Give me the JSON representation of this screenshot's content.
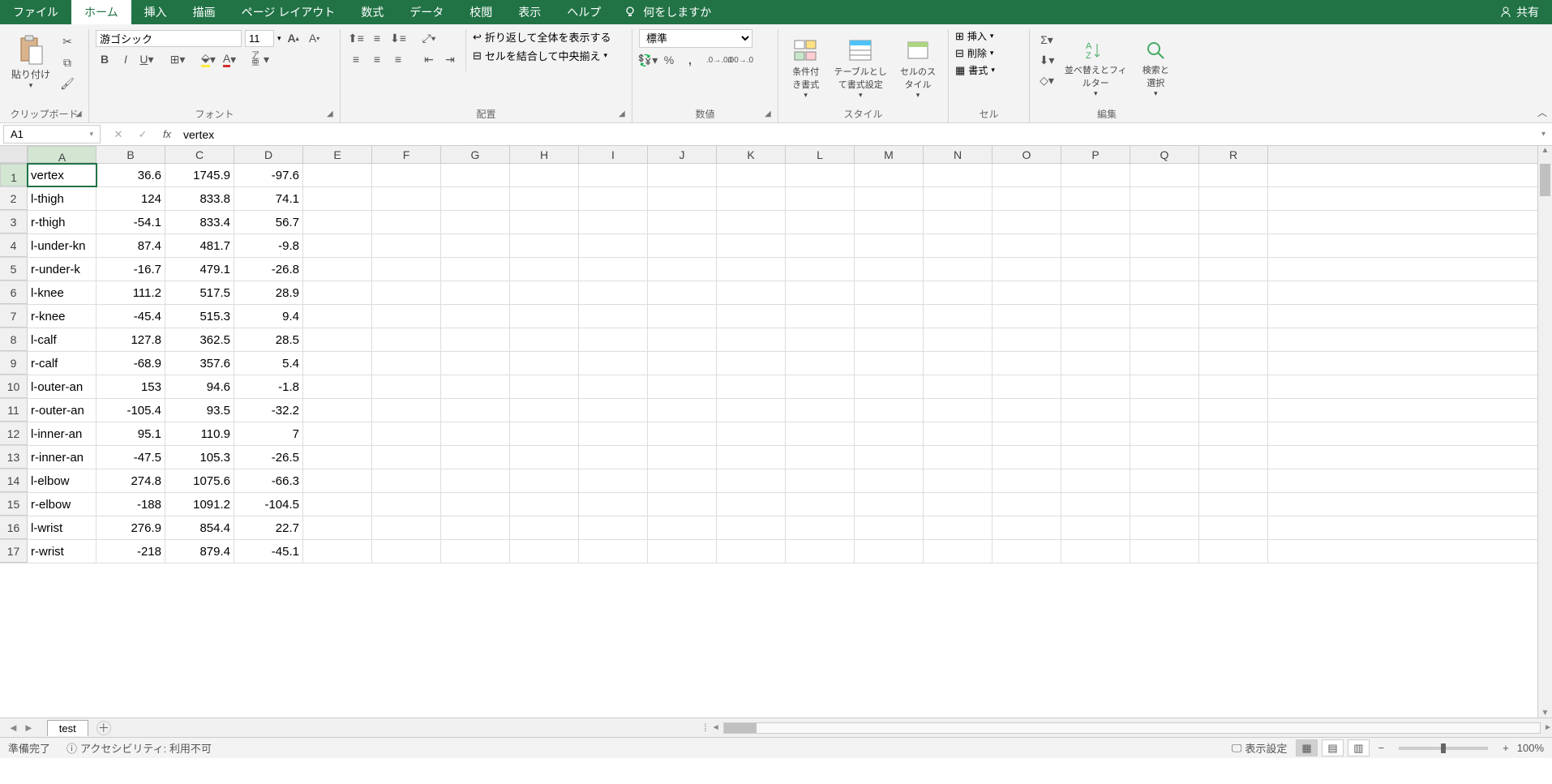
{
  "tabs": [
    "ファイル",
    "ホーム",
    "挿入",
    "描画",
    "ページ レイアウト",
    "数式",
    "データ",
    "校閲",
    "表示",
    "ヘルプ"
  ],
  "active_tab": 1,
  "tellme": "何をしますか",
  "share": "共有",
  "ribbon": {
    "clipboard": {
      "paste": "貼り付け",
      "label": "クリップボード"
    },
    "font": {
      "name": "游ゴシック",
      "size": "11",
      "label": "フォント",
      "ruby": "ア亜"
    },
    "alignment": {
      "wrap": "折り返して全体を表示する",
      "merge": "セルを結合して中央揃え",
      "label": "配置"
    },
    "number": {
      "format": "標準",
      "label": "数値"
    },
    "styles": {
      "cond": "条件付き書式",
      "table": "テーブルとして書式設定",
      "cell": "セルのスタイル",
      "label": "スタイル"
    },
    "cells": {
      "insert": "挿入",
      "delete": "削除",
      "format": "書式",
      "label": "セル"
    },
    "editing": {
      "sort": "並べ替えとフィルター",
      "find": "検索と選択",
      "label": "編集"
    }
  },
  "namebox": "A1",
  "formula": "vertex",
  "columns": [
    "A",
    "B",
    "C",
    "D",
    "E",
    "F",
    "G",
    "H",
    "I",
    "J",
    "K",
    "L",
    "M",
    "N",
    "O",
    "P",
    "Q",
    "R"
  ],
  "rows": [
    {
      "a": "vertex",
      "b": "36.6",
      "c": "1745.9",
      "d": "-97.6"
    },
    {
      "a": "l-thigh",
      "b": "124",
      "c": "833.8",
      "d": "74.1"
    },
    {
      "a": "r-thigh",
      "b": "-54.1",
      "c": "833.4",
      "d": "56.7"
    },
    {
      "a": "l-under-kn",
      "b": "87.4",
      "c": "481.7",
      "d": "-9.8"
    },
    {
      "a": "r-under-k",
      "b": "-16.7",
      "c": "479.1",
      "d": "-26.8"
    },
    {
      "a": "l-knee",
      "b": "111.2",
      "c": "517.5",
      "d": "28.9"
    },
    {
      "a": "r-knee",
      "b": "-45.4",
      "c": "515.3",
      "d": "9.4"
    },
    {
      "a": "l-calf",
      "b": "127.8",
      "c": "362.5",
      "d": "28.5"
    },
    {
      "a": "r-calf",
      "b": "-68.9",
      "c": "357.6",
      "d": "5.4"
    },
    {
      "a": "l-outer-an",
      "b": "153",
      "c": "94.6",
      "d": "-1.8"
    },
    {
      "a": "r-outer-an",
      "b": "-105.4",
      "c": "93.5",
      "d": "-32.2"
    },
    {
      "a": "l-inner-an",
      "b": "95.1",
      "c": "110.9",
      "d": "7"
    },
    {
      "a": "r-inner-an",
      "b": "-47.5",
      "c": "105.3",
      "d": "-26.5"
    },
    {
      "a": "l-elbow",
      "b": "274.8",
      "c": "1075.6",
      "d": "-66.3"
    },
    {
      "a": "r-elbow",
      "b": "-188",
      "c": "1091.2",
      "d": "-104.5"
    },
    {
      "a": "l-wrist",
      "b": "276.9",
      "c": "854.4",
      "d": "22.7"
    },
    {
      "a": "r-wrist",
      "b": "-218",
      "c": "879.4",
      "d": "-45.1"
    }
  ],
  "sheet": {
    "name": "test"
  },
  "status": {
    "ready": "準備完了",
    "access": "アクセシビリティ: 利用不可",
    "display": "表示設定",
    "zoom": "100%"
  }
}
